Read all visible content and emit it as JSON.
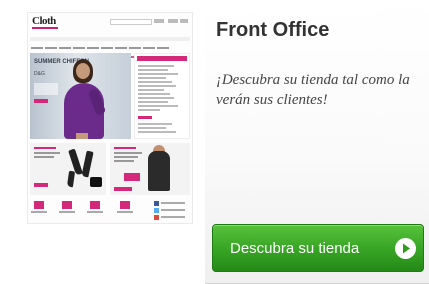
{
  "promo": {
    "title": "Front Office",
    "subtitle": "¡Descubra su tienda tal como la verán sus clientes!",
    "cta_label": "Descubra su tienda",
    "cta_icon": "play-circle-icon",
    "thumbnail": {
      "logo_text": "Cloth",
      "hero_heading": "SUMMER CHIFFON",
      "hero_brand": "D&G"
    }
  },
  "colors": {
    "title": "#333333",
    "cta_green": "#39a626",
    "accent_pink": "#d4287a",
    "dress_purple": "#6a2b8a"
  }
}
